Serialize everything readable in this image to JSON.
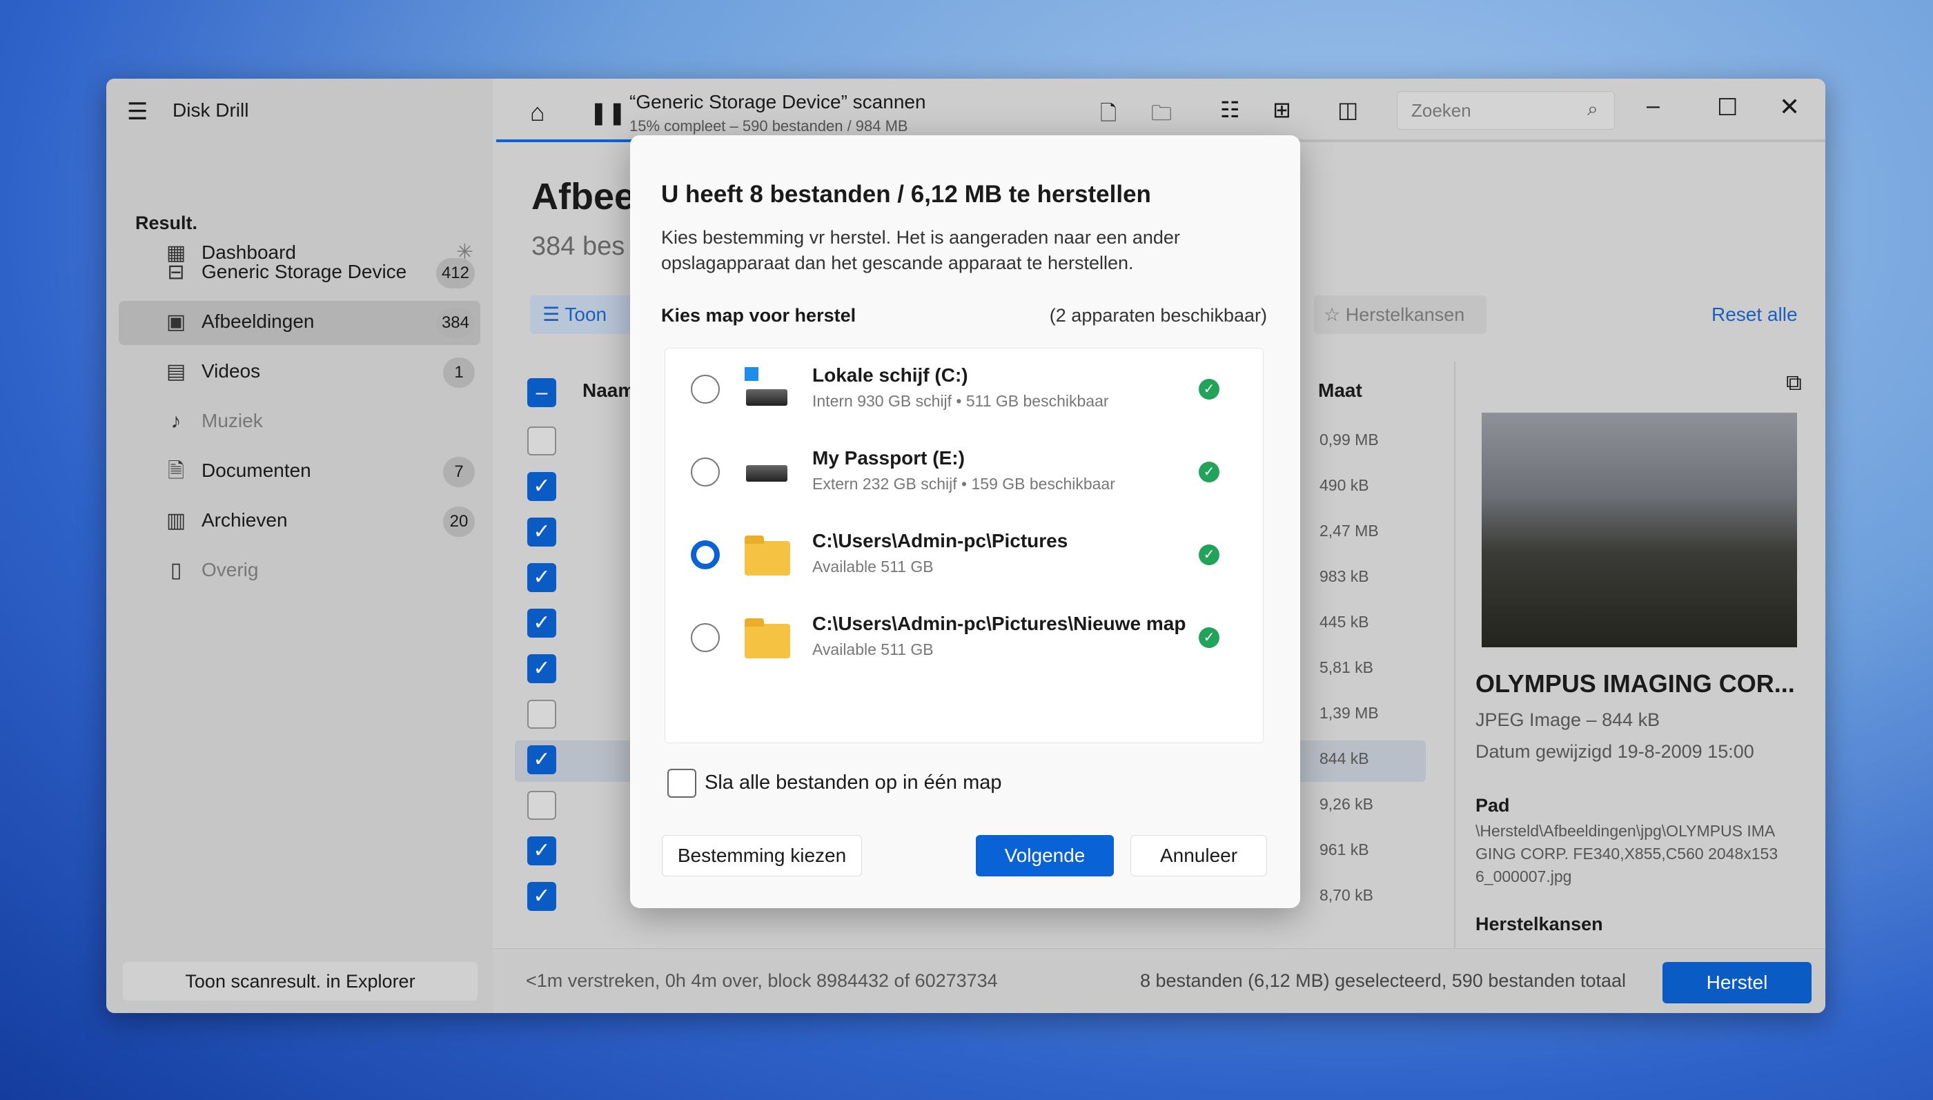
{
  "app": {
    "title": "Disk Drill"
  },
  "sidebar": {
    "items": [
      {
        "label": "Dashboard",
        "icon": "grid-icon"
      },
      {
        "section": "Result."
      },
      {
        "label": "Generic Storage Device",
        "badge": "412",
        "icon": "drive-icon"
      },
      {
        "label": "Afbeeldingen",
        "badge": "384",
        "icon": "image-icon",
        "selected": true
      },
      {
        "label": "Videos",
        "badge": "1",
        "icon": "film-icon"
      },
      {
        "label": "Muziek",
        "icon": "music-icon",
        "disabled": true
      },
      {
        "label": "Documenten",
        "badge": "7",
        "icon": "document-icon"
      },
      {
        "label": "Archieven",
        "badge": "20",
        "icon": "archive-icon"
      },
      {
        "label": "Overig",
        "icon": "other-icon",
        "disabled": true
      }
    ],
    "explorer_button": "Toon scanresult. in Explorer"
  },
  "toolbar": {
    "title": "“Generic Storage Device” scannen",
    "subtitle": "15% compleet – 590 bestanden / 984 MB",
    "search_placeholder": "Zoeken",
    "progress_percent": 15
  },
  "main": {
    "heading": "Afbee",
    "subheading": "384 bes",
    "filter_label": "Toon",
    "recovery_chances": "Herstelkansen",
    "reset_all": "Reset alle",
    "col_name": "Naam",
    "col_size": "Maat",
    "rows": [
      {
        "checked": false,
        "size": "0,99 MB"
      },
      {
        "checked": true,
        "size": "490 kB"
      },
      {
        "checked": true,
        "size": "2,47 MB"
      },
      {
        "checked": true,
        "size": "983 kB"
      },
      {
        "checked": true,
        "size": "445 kB"
      },
      {
        "checked": true,
        "size": "5,81 kB"
      },
      {
        "checked": false,
        "size": "1,39 MB"
      },
      {
        "checked": true,
        "size": "844 kB",
        "selected": true
      },
      {
        "checked": false,
        "size": "9,26 kB"
      },
      {
        "checked": true,
        "size": "961 kB"
      },
      {
        "checked": true,
        "size": "8,70 kB"
      }
    ]
  },
  "preview": {
    "title": "OLYMPUS IMAGING COR...",
    "type": "JPEG Image – 844 kB",
    "date": "Datum gewijzigd 19-8-2009 15:00",
    "path_label": "Pad",
    "path": "\\Hersteld\\Afbeeldingen\\jpg\\OLYMPUS IMAGING CORP. FE340,X855,C560 2048x1536_000007.jpg",
    "chances_label": "Herstelkansen"
  },
  "status": {
    "left": "<1m verstreken, 0h 4m over, block 8984432 of 60273734",
    "right": "8 bestanden (6,12 MB) geselecteerd, 590 bestanden totaal",
    "recover_button": "Herstel"
  },
  "dialog": {
    "title": "U heeft 8 bestanden / 6,12 MB te herstellen",
    "description": "Kies bestemming vr herstel. Het is aangeraden naar een ander opslagapparaat dan het gescande apparaat te herstellen.",
    "choose_label": "Kies map voor herstel",
    "available": "(2 apparaten beschikbaar)",
    "destinations": [
      {
        "name": "Lokale schijf (C:)",
        "detail": "Intern 930 GB schijf • 511 GB beschikbaar",
        "icon": "windows-drive-icon",
        "selected": false
      },
      {
        "name": "My Passport (E:)",
        "detail": "Extern 232 GB schijf • 159 GB beschikbaar",
        "icon": "external-drive-icon",
        "selected": false
      },
      {
        "name": "C:\\Users\\Admin-pc\\Pictures",
        "detail": "Available 511 GB",
        "icon": "folder-icon",
        "selected": true
      },
      {
        "name": "C:\\Users\\Admin-pc\\Pictures\\Nieuwe map",
        "detail": "Available 511 GB",
        "icon": "folder-icon",
        "selected": false
      }
    ],
    "single_folder_label": "Sla alle bestanden op in één map",
    "single_folder_checked": false,
    "choose_button": "Bestemming kiezen",
    "next_button": "Volgende",
    "cancel_button": "Annuleer"
  },
  "colors": {
    "accent": "#0a63d6",
    "success": "#22a35a"
  }
}
